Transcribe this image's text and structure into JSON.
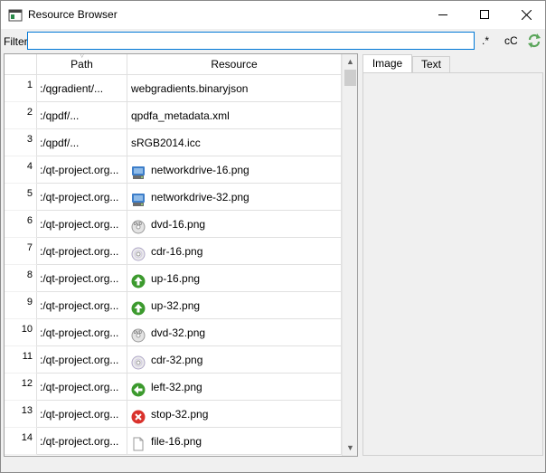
{
  "window": {
    "title": "Resource Browser",
    "controls": {
      "minimize": "minimize",
      "maximize": "maximize",
      "close": "close"
    }
  },
  "filter": {
    "label": "Filter",
    "value": "",
    "placeholder": "",
    "regex_label": ".*",
    "case_label": "cC"
  },
  "table": {
    "columns": [
      "Path",
      "Resource"
    ],
    "rows": [
      {
        "num": "1",
        "path": ":/qgradient/...",
        "resource": "webgradients.binaryjson",
        "icon": "none"
      },
      {
        "num": "2",
        "path": ":/qpdf/...",
        "resource": "qpdfa_metadata.xml",
        "icon": "none"
      },
      {
        "num": "3",
        "path": ":/qpdf/...",
        "resource": "sRGB2014.icc",
        "icon": "none"
      },
      {
        "num": "4",
        "path": ":/qt-project.org...",
        "resource": "networkdrive-16.png",
        "icon": "network-drive-icon"
      },
      {
        "num": "5",
        "path": ":/qt-project.org...",
        "resource": "networkdrive-32.png",
        "icon": "network-drive-icon"
      },
      {
        "num": "6",
        "path": ":/qt-project.org...",
        "resource": "dvd-16.png",
        "icon": "dvd-icon"
      },
      {
        "num": "7",
        "path": ":/qt-project.org...",
        "resource": "cdr-16.png",
        "icon": "cd-icon"
      },
      {
        "num": "8",
        "path": ":/qt-project.org...",
        "resource": "up-16.png",
        "icon": "arrow-up-icon"
      },
      {
        "num": "9",
        "path": ":/qt-project.org...",
        "resource": "up-32.png",
        "icon": "arrow-up-icon"
      },
      {
        "num": "10",
        "path": ":/qt-project.org...",
        "resource": "dvd-32.png",
        "icon": "dvd-icon"
      },
      {
        "num": "11",
        "path": ":/qt-project.org...",
        "resource": "cdr-32.png",
        "icon": "cd-icon"
      },
      {
        "num": "12",
        "path": ":/qt-project.org...",
        "resource": "left-32.png",
        "icon": "arrow-left-icon"
      },
      {
        "num": "13",
        "path": ":/qt-project.org...",
        "resource": "stop-32.png",
        "icon": "stop-icon"
      },
      {
        "num": "14",
        "path": ":/qt-project.org...",
        "resource": "file-16.png",
        "icon": "file-icon"
      }
    ]
  },
  "preview": {
    "tabs": [
      "Image",
      "Text"
    ],
    "active_tab": "Image"
  },
  "colors": {
    "accent": "#0078d7",
    "green_arrow": "#3c9a2e",
    "stop_red": "#d9312b"
  }
}
